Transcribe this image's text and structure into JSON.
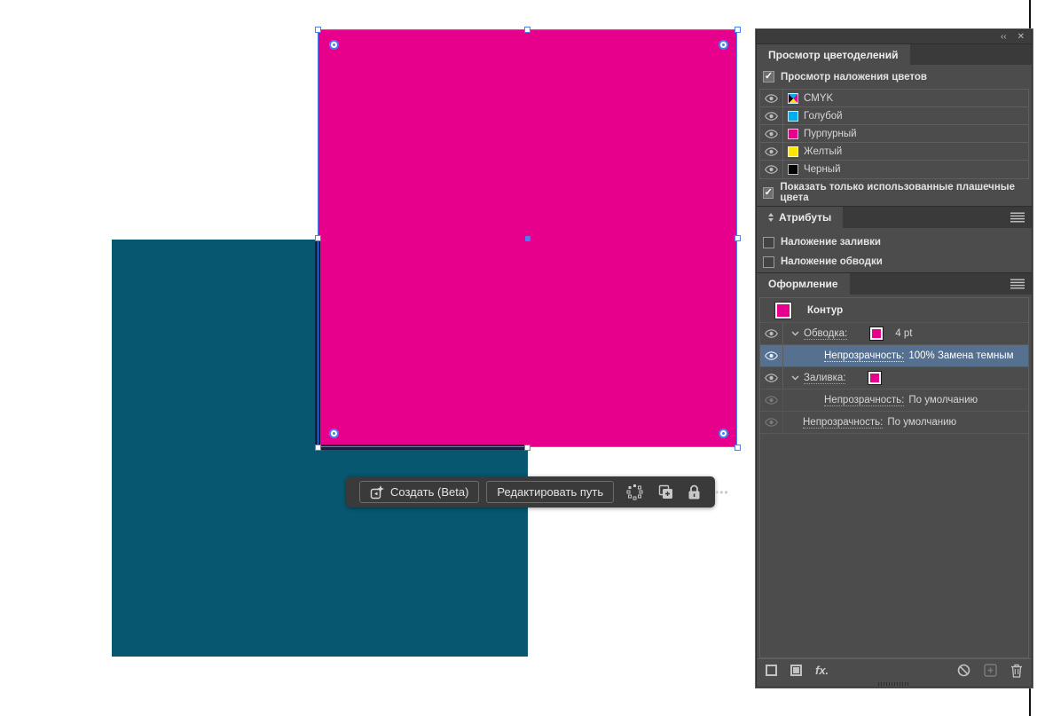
{
  "canvas": {
    "teal_rect_color": "#075770",
    "magenta_square_fill": "#E6008C",
    "overlap_stroke_color": "#1A1E41",
    "selection_color": "#4A80F2"
  },
  "icons": {
    "collapse": "‹‹",
    "close": "✕",
    "ellipsis": "•••",
    "check": "✓",
    "fx_label": "fx."
  },
  "taskbar": {
    "generate_label": "Создать (Beta)",
    "edit_path_label": "Редактировать путь"
  },
  "separations_panel": {
    "tab_title": "Просмотр цветоделений",
    "overprint_checkbox": {
      "label": "Просмотр наложения цветов",
      "checked": true
    },
    "rows": [
      {
        "label": "CMYK",
        "swatch": "cmyk",
        "color": "CMYK",
        "visible": true
      },
      {
        "label": "Голубой",
        "swatch": "cyan",
        "color": "#00AEEF",
        "visible": true
      },
      {
        "label": "Пурпурный",
        "swatch": "magenta",
        "color": "#E6008C",
        "visible": true
      },
      {
        "label": "Желтый",
        "swatch": "yellow",
        "color": "#FFE600",
        "visible": true
      },
      {
        "label": "Черный",
        "swatch": "black",
        "color": "#000000",
        "visible": true
      }
    ],
    "used_only_checkbox": {
      "label": "Показать только использованные плашечные цвета",
      "checked": true
    }
  },
  "attributes_panel": {
    "title": "Атрибуты",
    "checkboxes": [
      {
        "label": "Наложение заливки",
        "checked": false
      },
      {
        "label": "Наложение обводки",
        "checked": false
      }
    ]
  },
  "appearance_panel": {
    "title": "Оформление",
    "target_row": {
      "label": "Контур"
    },
    "rows": [
      {
        "label": "Обводка:",
        "value": "4 pt",
        "visible": true,
        "selected": false
      },
      {
        "label": "Непрозрачность:",
        "value": "100% Замена темным",
        "visible": true,
        "selected": true
      },
      {
        "label": "Заливка:",
        "value": "",
        "visible": true,
        "selected": false
      },
      {
        "label": "Непрозрачность:",
        "value": "По умолчанию",
        "visible": false,
        "selected": false
      },
      {
        "label": "Непрозрачность:",
        "value": "По умолчанию",
        "visible": false,
        "selected": false
      }
    ]
  }
}
